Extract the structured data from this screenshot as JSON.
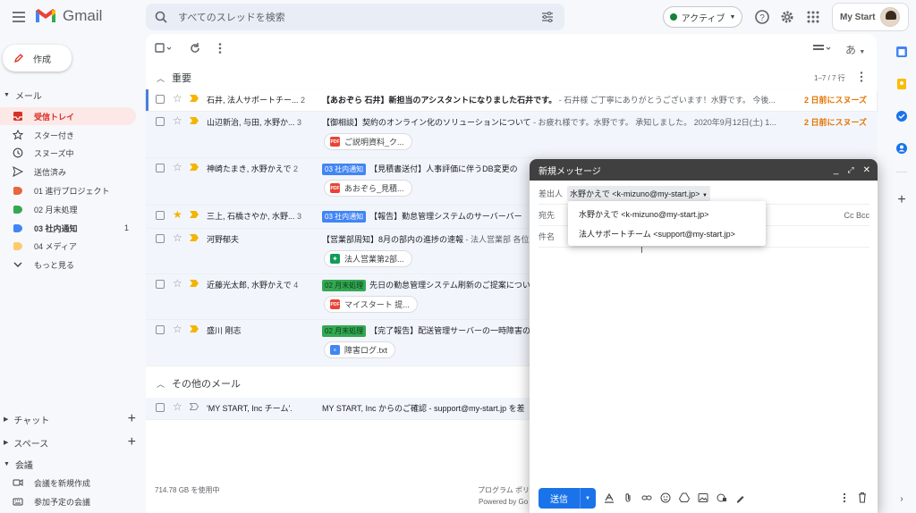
{
  "app": {
    "name": "Gmail"
  },
  "search": {
    "placeholder": "すべてのスレッドを検索"
  },
  "status": {
    "label": "アクティブ"
  },
  "account": {
    "label": "My Start"
  },
  "compose_button": {
    "label": "作成"
  },
  "sidebar": {
    "mail_header": "メール",
    "items": [
      {
        "label": "受信トレイ",
        "icon": "inbox-icon",
        "active": true
      },
      {
        "label": "スター付き",
        "icon": "star-icon"
      },
      {
        "label": "スヌーズ中",
        "icon": "clock-icon"
      },
      {
        "label": "送信済み",
        "icon": "send-icon"
      },
      {
        "label": "01 進行プロジェクト",
        "icon": "label-icon",
        "color": "#e8663d"
      },
      {
        "label": "02 月末処理",
        "icon": "label-icon",
        "color": "#34a853"
      },
      {
        "label": "03 社内通知",
        "icon": "label-icon",
        "color": "#4285f4",
        "count": "1"
      },
      {
        "label": "04 メディア",
        "icon": "label-icon",
        "color": "#fbcb6e"
      },
      {
        "label": "もっと見る",
        "icon": "chevron-down-icon"
      }
    ],
    "chat": "チャット",
    "spaces": "スペース",
    "meet": "会議",
    "meet_items": [
      "会議を新規作成",
      "参加予定の会議"
    ]
  },
  "main": {
    "important_header": "重要",
    "pagination": "1–7 / 7 行",
    "other_header": "その他のメール",
    "storage": "714.78 GB を使用中",
    "footer_program": "プログラム ポリ",
    "footer_powered": "Powered by Go"
  },
  "rows": [
    {
      "sender": "石井, 法人サポートチー...",
      "count": "2",
      "tag": "",
      "subject": "【あおぞら 石井】新担当のアシスタントになりました石井です。",
      "snippet": " - 石井様 ご丁寧にありがとうございます！水野です。 今後...",
      "right": "2 日前にスヌーズ",
      "starred": false
    },
    {
      "sender": "山辺新治, 与田, 水野か...",
      "count": "3",
      "tag": "",
      "subject": "【御相談】契約のオンライン化のソリューションについて",
      "snippet": " - お疲れ様です。水野です。 承知しました。 2020年9月12日(土) 1...",
      "right": "2 日前にスヌーズ",
      "starred": false,
      "attachment": "ご説明資料_ク...",
      "att_type": "pdf"
    },
    {
      "sender": "神崎たまき, 水野かえで",
      "count": "2",
      "tag": "03 社内通知",
      "tag_color": "blue",
      "subject": "【見積書送付】人事評価に伴うDB変更の",
      "snippet": "",
      "right": "",
      "starred": false,
      "attachment": "あおぞら_見積...",
      "att_type": "pdf"
    },
    {
      "sender": "三上, 石橋さやか, 水野...",
      "count": "3",
      "tag": "03 社内通知",
      "tag_color": "blue",
      "subject": "【報告】勤怠管理システムのサーバーバー",
      "snippet": "",
      "right": "",
      "starred": true
    },
    {
      "sender": "河野郁夫",
      "count": "",
      "tag": "",
      "subject": "【営業部周知】8月の部内の進捗の速報",
      "snippet": " - 法人営業部 各位",
      "right": "",
      "starred": false,
      "attachment": "法人営業第2部...",
      "att_type": "sheet"
    },
    {
      "sender": "近藤光太郎, 水野かえで",
      "count": "4",
      "tag": "02 月末処理",
      "tag_color": "green",
      "subject": "先日の勤怠管理システム刷新のご提案につい",
      "snippet": "",
      "right": "",
      "starred": false,
      "attachment": "マイスタート 提...",
      "att_type": "pdf"
    },
    {
      "sender": "盛川 剛志",
      "count": "",
      "tag": "02 月末処理",
      "tag_color": "green",
      "subject": "【完了報告】配送管理サーバーの一時障害の",
      "snippet": "",
      "right": "",
      "starred": false,
      "attachment": "障害ログ.txt",
      "att_type": "doc"
    }
  ],
  "other_rows": [
    {
      "sender": "'MY START, Inc チーム'.",
      "subject": "MY START, Inc からのご確認 - support@my-start.jp を差"
    }
  ],
  "compose": {
    "title": "新規メッセージ",
    "from_label": "差出人",
    "from_value": "水野かえで <k-mizuno@my-start.jp>",
    "to_label": "宛先",
    "cc_bcc": "Cc Bcc",
    "subject_label": "件名",
    "send_label": "送信",
    "from_options": [
      "水野かえで <k-mizuno@my-start.jp>",
      "法人サポートチーム <support@my-start.jp>"
    ]
  },
  "colors": {
    "accent": "#1a73e8",
    "snooze": "#e37400",
    "inbox_active": "#d93025"
  }
}
